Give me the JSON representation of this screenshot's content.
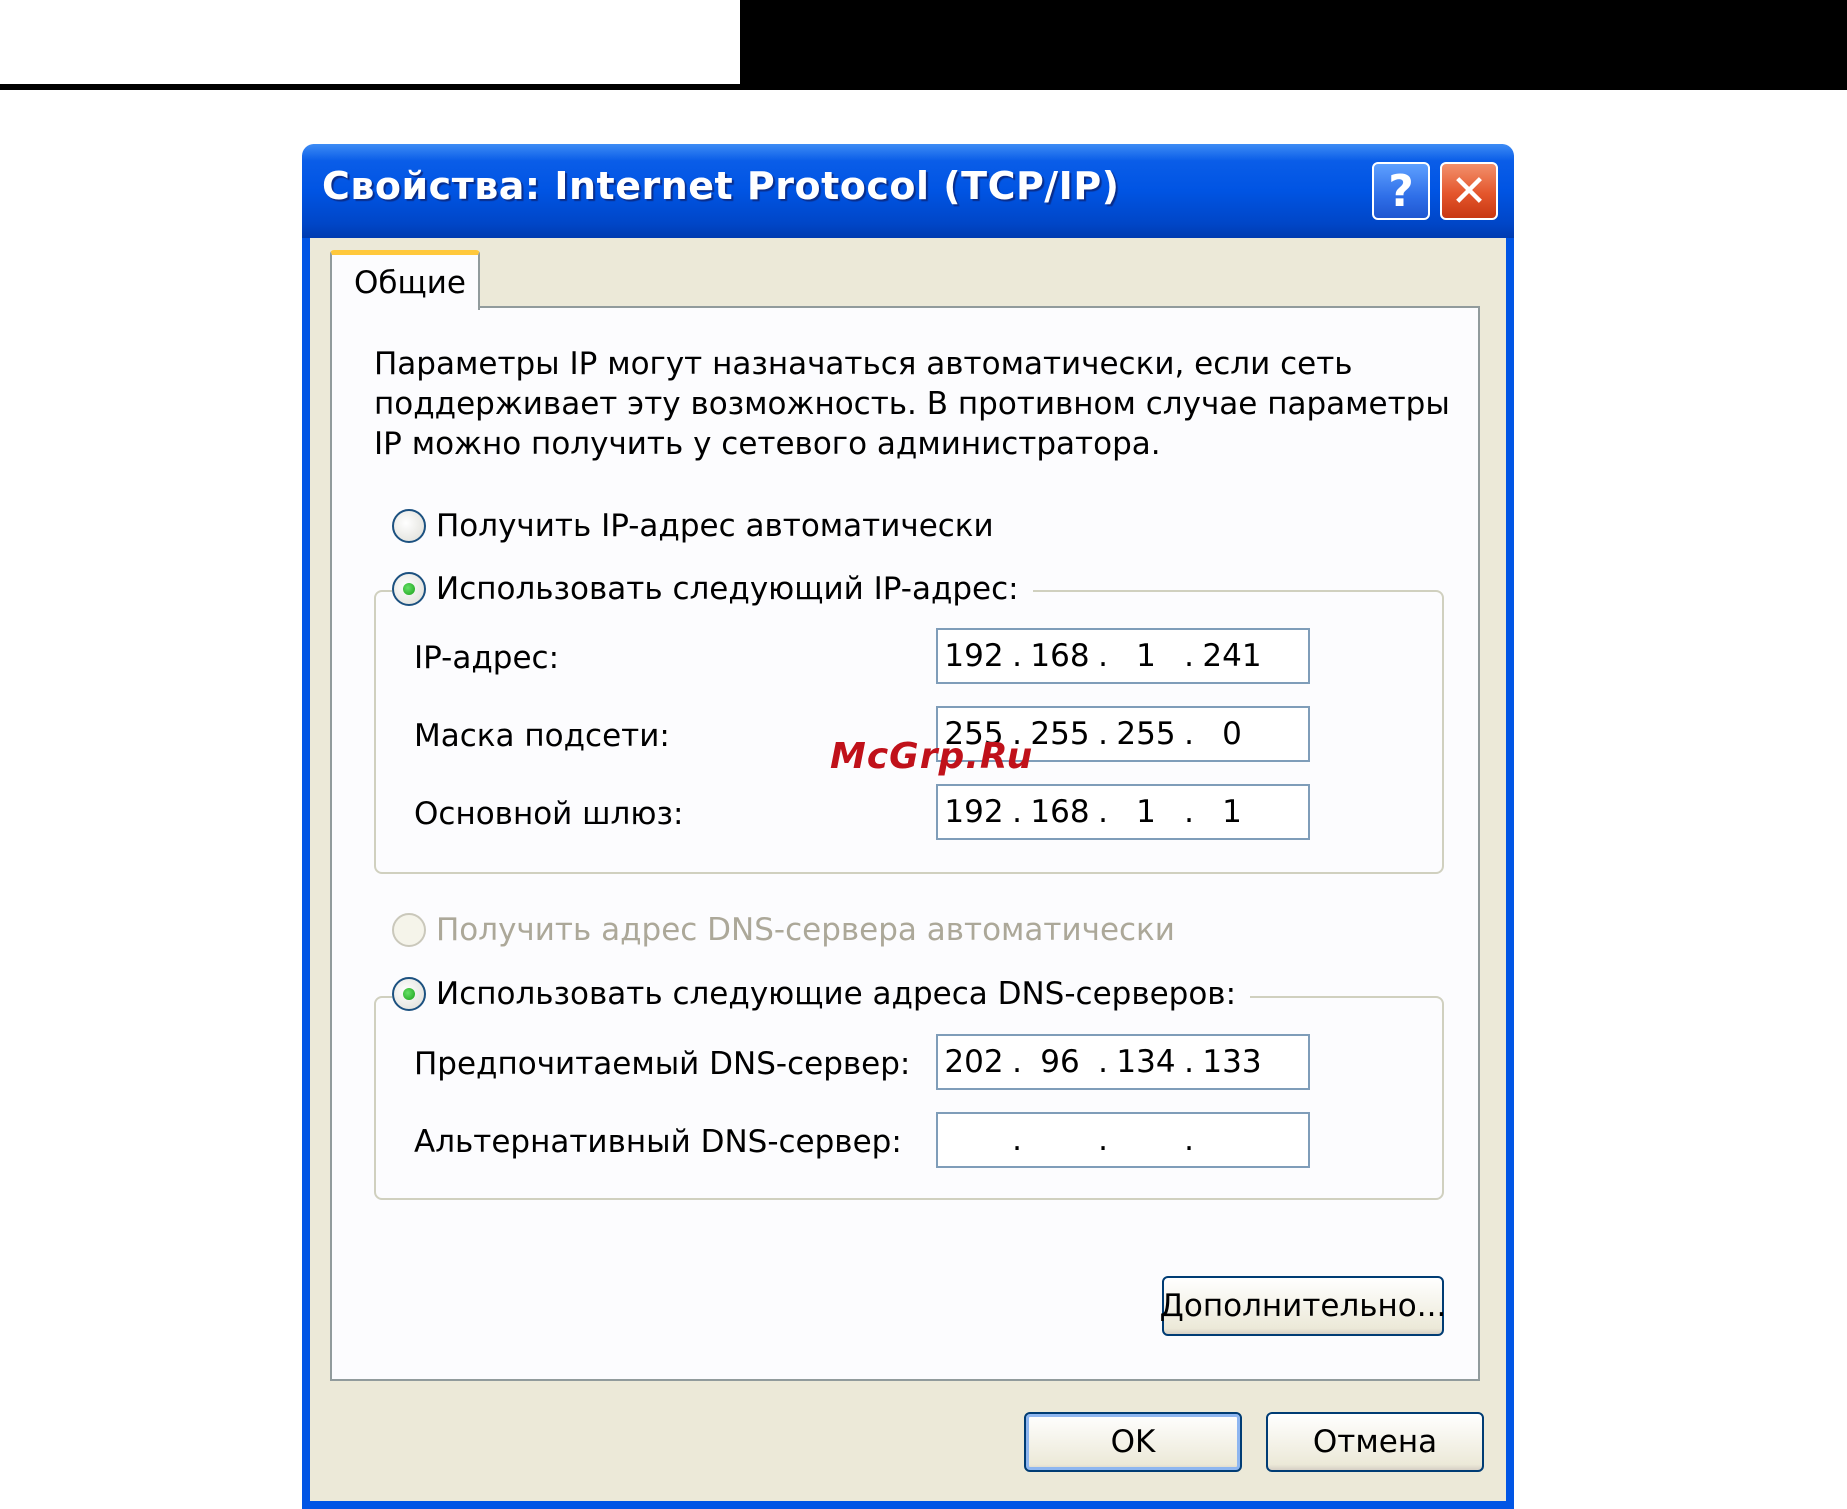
{
  "window": {
    "title": "Свойства: Internet Protocol (TCP/IP)",
    "help_glyph": "?",
    "close_glyph": "✕"
  },
  "tabs": [
    {
      "label": "Общие",
      "selected": true
    }
  ],
  "description": [
    "Параметры IP могут назначаться автоматически, если сеть",
    "поддерживает эту возможность. В противном случае параметры",
    "IP можно получить у сетевого администратора."
  ],
  "ip_section": {
    "auto_radio_label": "Получить IP-адрес автоматически",
    "auto_selected": false,
    "manual_radio_label": "Использовать следующий IP-адрес:",
    "manual_selected": true,
    "fields": [
      {
        "label": "IP-адрес:",
        "octets": [
          "192",
          "168",
          "1",
          "241"
        ]
      },
      {
        "label": "Маска подсети:",
        "octets": [
          "255",
          "255",
          "255",
          "0"
        ]
      },
      {
        "label": "Основной шлюз:",
        "octets": [
          "192",
          "168",
          "1",
          "1"
        ]
      }
    ]
  },
  "dns_section": {
    "auto_radio_label": "Получить адрес DNS-сервера автоматически",
    "auto_selected": false,
    "auto_disabled": true,
    "manual_radio_label": "Использовать следующие адреса DNS-серверов:",
    "manual_selected": true,
    "fields": [
      {
        "label": "Предпочитаемый DNS-сервер:",
        "octets": [
          "202",
          "96",
          "134",
          "133"
        ]
      },
      {
        "label": "Альтернативный DNS-сервер:",
        "octets": [
          "",
          "",
          "",
          ""
        ]
      }
    ]
  },
  "buttons": {
    "advanced": "Дополнительно...",
    "ok": "OK",
    "cancel": "Отмена"
  },
  "watermark": "McGrp.Ru",
  "colors": {
    "titlebar": "#0054e3",
    "face": "#ece9d8",
    "radio_dot": "#19a019",
    "close_button": "#e4562c"
  }
}
